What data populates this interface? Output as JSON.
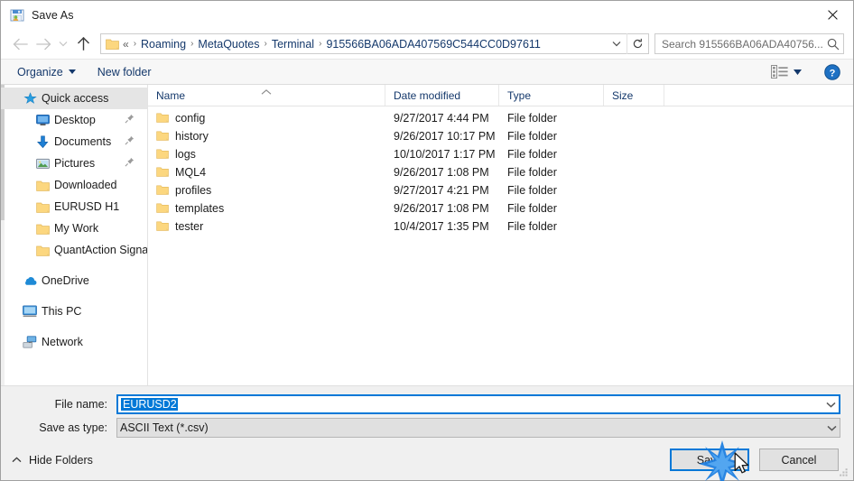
{
  "window": {
    "title": "Save As",
    "icon": "save-as-icon",
    "close_label": "Close"
  },
  "nav": {
    "back_icon": "back-arrow-icon",
    "forward_icon": "forward-arrow-icon",
    "recent_icon": "chevron-down-icon",
    "up_icon": "up-arrow-icon",
    "refresh_icon": "refresh-icon",
    "address_caret_icon": "chevron-down-icon",
    "breadcrumb_prefix": "«",
    "breadcrumbs": [
      "Roaming",
      "MetaQuotes",
      "Terminal",
      "915566BA06ADA407569C544CC0D97611"
    ],
    "separator": "›"
  },
  "search": {
    "placeholder": "Search 915566BA06ADA40756...",
    "value": "",
    "icon": "search-icon"
  },
  "toolbar": {
    "organize_label": "Organize",
    "organize_caret_icon": "caret-down-icon",
    "new_folder_label": "New folder",
    "view_icon": "view-layout-icon",
    "view_caret_icon": "caret-down-icon",
    "help_icon": "help-icon"
  },
  "sidebar": {
    "items": [
      {
        "label": "Quick access",
        "icon": "star-icon",
        "selected": true,
        "indent": false,
        "pinned": false
      },
      {
        "label": "Desktop",
        "icon": "desktop-icon",
        "selected": false,
        "indent": true,
        "pinned": true
      },
      {
        "label": "Documents",
        "icon": "documents-icon",
        "selected": false,
        "indent": true,
        "pinned": true
      },
      {
        "label": "Pictures",
        "icon": "pictures-icon",
        "selected": false,
        "indent": true,
        "pinned": true
      },
      {
        "label": "Downloaded",
        "icon": "folder-icon",
        "selected": false,
        "indent": true,
        "pinned": false
      },
      {
        "label": "EURUSD H1",
        "icon": "folder-icon",
        "selected": false,
        "indent": true,
        "pinned": false
      },
      {
        "label": "My Work",
        "icon": "folder-icon",
        "selected": false,
        "indent": true,
        "pinned": false
      },
      {
        "label": "QuantAction Signal",
        "icon": "folder-icon",
        "selected": false,
        "indent": true,
        "pinned": false
      },
      {
        "label": "OneDrive",
        "icon": "onedrive-icon",
        "selected": false,
        "indent": false,
        "pinned": false,
        "gap_before": true
      },
      {
        "label": "This PC",
        "icon": "thispc-icon",
        "selected": false,
        "indent": false,
        "pinned": false,
        "gap_before": true
      },
      {
        "label": "Network",
        "icon": "network-icon",
        "selected": false,
        "indent": false,
        "pinned": false,
        "gap_before": true
      }
    ]
  },
  "filelist": {
    "columns": [
      "Name",
      "Date modified",
      "Type",
      "Size"
    ],
    "sort_column": "Name",
    "sort_direction": "ascending",
    "rows": [
      {
        "name": "config",
        "date": "9/27/2017 4:44 PM",
        "type": "File folder",
        "size": ""
      },
      {
        "name": "history",
        "date": "9/26/2017 10:17 PM",
        "type": "File folder",
        "size": ""
      },
      {
        "name": "logs",
        "date": "10/10/2017 1:17 PM",
        "type": "File folder",
        "size": ""
      },
      {
        "name": "MQL4",
        "date": "9/26/2017 1:08 PM",
        "type": "File folder",
        "size": ""
      },
      {
        "name": "profiles",
        "date": "9/27/2017 4:21 PM",
        "type": "File folder",
        "size": ""
      },
      {
        "name": "templates",
        "date": "9/26/2017 1:08 PM",
        "type": "File folder",
        "size": ""
      },
      {
        "name": "tester",
        "date": "10/4/2017 1:35 PM",
        "type": "File folder",
        "size": ""
      }
    ]
  },
  "form": {
    "filename_label": "File name:",
    "filename_value": "EURUSD2",
    "filename_selected": true,
    "filetype_label": "Save as type:",
    "filetype_value": "ASCII Text (*.csv)",
    "caret_icon": "chevron-down-icon"
  },
  "footer": {
    "hide_folders_label": "Hide Folders",
    "hide_folders_icon": "caret-up-icon",
    "save_label": "Save",
    "cancel_label": "Cancel",
    "default_button": "Save",
    "resize_grip_icon": "resize-grip-icon"
  },
  "overlay": {
    "click_burst_icon": "click-burst-icon",
    "cursor_icon": "mouse-pointer-icon"
  },
  "colors": {
    "accent": "#0078d7",
    "breadcrumb_link": "#14386b",
    "folder_yellow": "#fcd77f",
    "selection_bg": "#e5e5e5",
    "panel_bg": "#f0f0f0"
  }
}
